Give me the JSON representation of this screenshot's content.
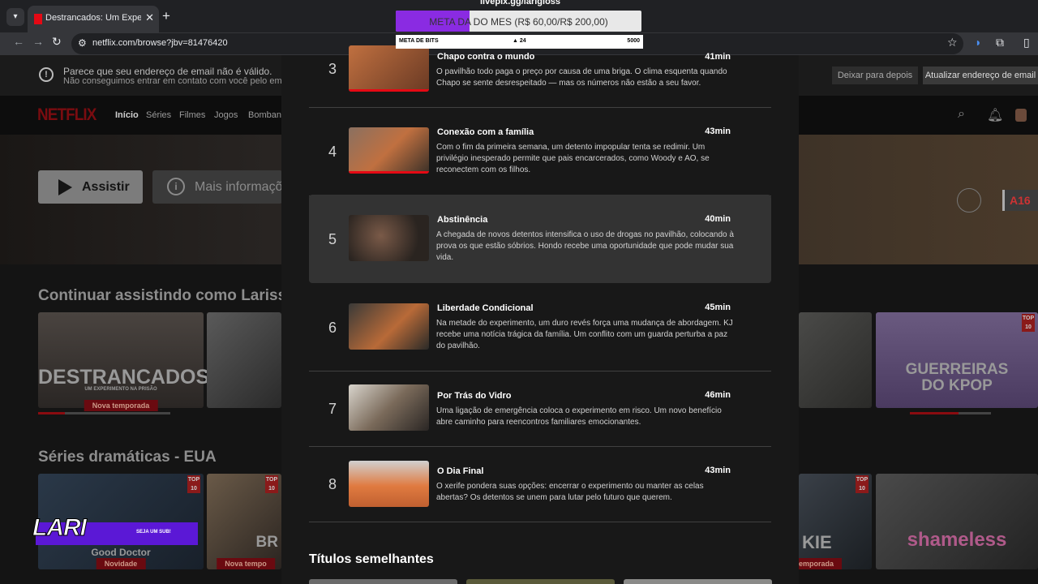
{
  "browser": {
    "tab_title": "Destrancados: Um Experimento",
    "url": "netflix.com/browse?jbv=81476420"
  },
  "banner": {
    "line1": "Parece que seu endereço de email não é válido.",
    "line2": "Não conseguimos entrar em contato com você pelo email que",
    "btn_later": "Deixar para depois",
    "btn_update": "Atualizar endereço de email"
  },
  "nav": {
    "logo": "NETFLIX",
    "links": [
      "Início",
      "Séries",
      "Filmes",
      "Jogos",
      "Bombando"
    ]
  },
  "hero": {
    "play": "Assistir",
    "info": "Mais informações",
    "rating": "A16"
  },
  "rows": {
    "continue_title": "Continuar assistindo como Larissa D",
    "drama_title": "Séries dramáticas - EUA",
    "cards": {
      "destrancados_title": "DESTRANCADOS",
      "destrancados_sub": "UM EXPERIMENTO NA PRISÃO",
      "destrancados_badge": "Nova temporada",
      "kpop_title_1": "GUERREIRAS",
      "kpop_title_2": "DO KPOP",
      "top10": "TOP 10",
      "gooddoctor": "Good Doctor",
      "gooddoctor_badge": "Novidade",
      "br_title": "BR",
      "br_badge": "Nova tempo",
      "rookie": "KIE",
      "rookie_badge": "temporada",
      "shameless": "shameless"
    }
  },
  "episodes": [
    {
      "num": "3",
      "title": "Chapo contra o mundo",
      "duration": "41min",
      "desc": "O pavilhão todo paga o preço por causa de uma briga. O clima esquenta quando Chapo se sente desrespeitado — mas os números não estão a seu favor."
    },
    {
      "num": "4",
      "title": "Conexão com a família",
      "duration": "43min",
      "desc": "Com o fim da primeira semana, um detento impopular tenta se redimir. Um privilégio inesperado permite que pais encarcerados, como Woody e AO, se reconectem com os filhos."
    },
    {
      "num": "5",
      "title": "Abstinência",
      "duration": "40min",
      "desc": "A chegada de novos detentos intensifica o uso de drogas no pavilhão, colocando à prova os que estão sóbrios. Hondo recebe uma oportunidade que pode mudar sua vida."
    },
    {
      "num": "6",
      "title": "Liberdade Condicional",
      "duration": "45min",
      "desc": "Na metade do experimento, um duro revés força uma mudança de abordagem. KJ recebe uma notícia trágica da família. Um conflito com um guarda perturba a paz do pavilhão."
    },
    {
      "num": "7",
      "title": "Por Trás do Vidro",
      "duration": "46min",
      "desc": "Uma ligação de emergência coloca o experimento em risco. Um novo benefício abre caminho para reencontros familiares emocionantes."
    },
    {
      "num": "8",
      "title": "O Dia Final",
      "duration": "43min",
      "desc": "O xerife pondera suas opções: encerrar o experimento ou manter as celas abertas? Os detentos se unem para lutar pelo futuro que querem."
    }
  ],
  "similar_title": "Títulos semelhantes",
  "overlay": {
    "url": "livepix.gg/larigloss",
    "goal_text": "META DA DO MES (R$ 60,00/R$ 200,00)",
    "goal_fraction": 0.3,
    "bits_label": "META DE BITS",
    "bits_value": "24",
    "bits_goal": "5000",
    "lari": "LARI",
    "sub_text": "SEJA UM SUB!"
  },
  "colors": {
    "netflix_red": "#e50914",
    "purple": "#8a2be2"
  }
}
